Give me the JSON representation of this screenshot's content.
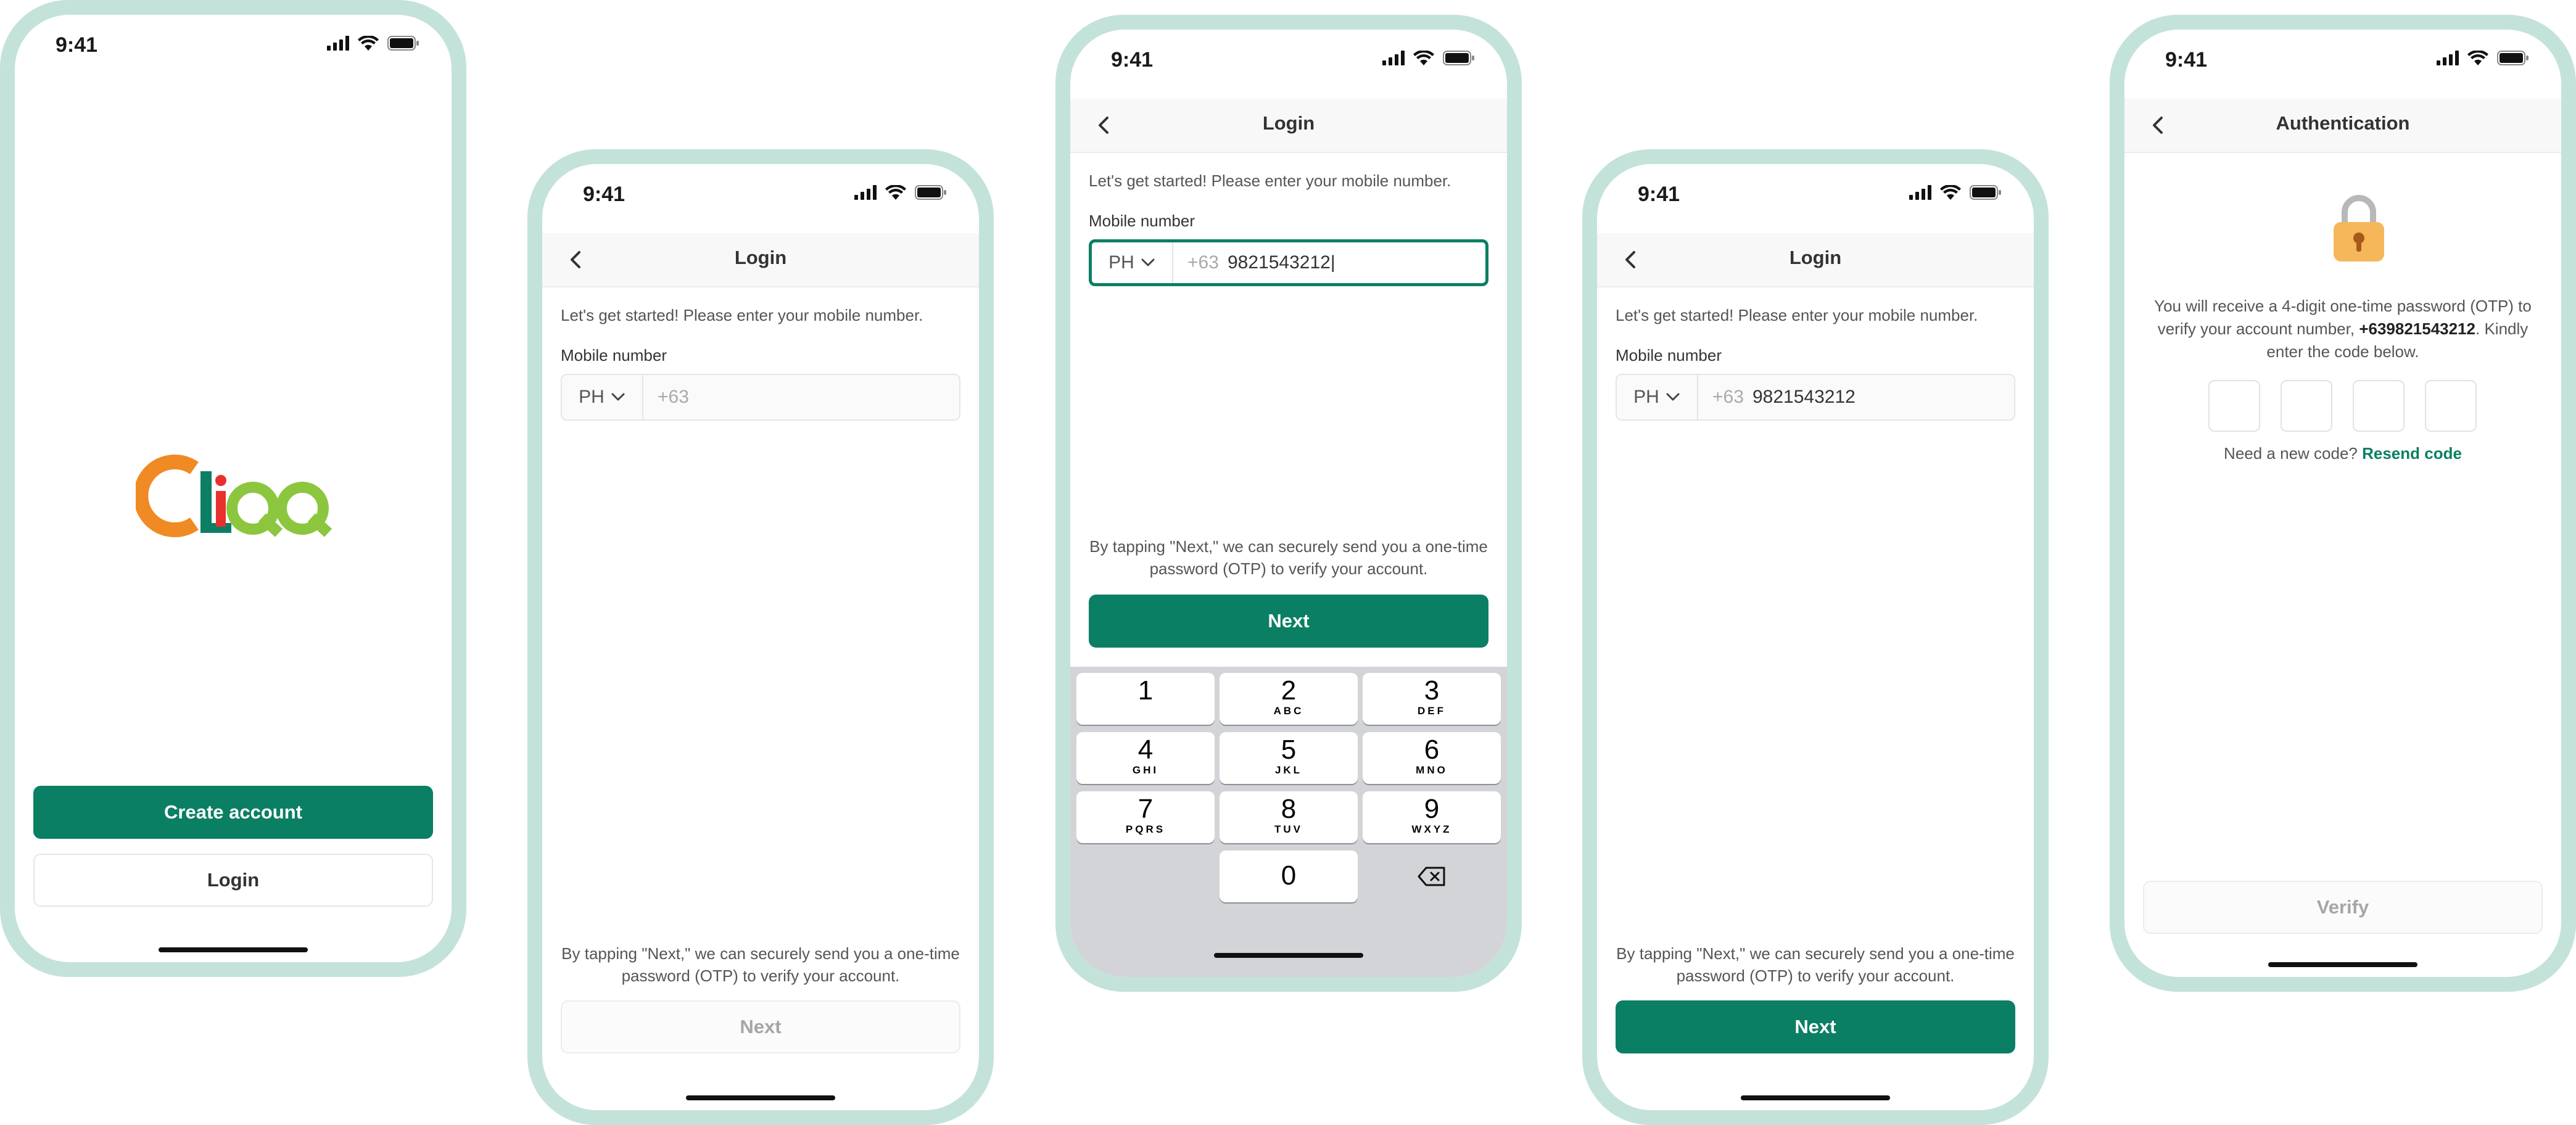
{
  "status": {
    "time": "9:41"
  },
  "brand": {
    "logo_text": "CliQQ",
    "green": "#0b7f63",
    "phone_frame": "#c3e3da"
  },
  "welcome": {
    "create_account": "Create account",
    "login": "Login"
  },
  "login_common": {
    "title": "Login",
    "intro": "Let's get started! Please enter your mobile number.",
    "mobile_label": "Mobile number",
    "country_code": "PH",
    "dial_prefix": "+63",
    "terms": "By tapping \"Next,\" we can securely send you a one-time password (OTP) to verify your account.",
    "next": "Next"
  },
  "login_typing": {
    "number": "9821543212|"
  },
  "login_filled": {
    "number": "9821543212"
  },
  "keyboard": {
    "keys": [
      {
        "digit": "1",
        "letters": ""
      },
      {
        "digit": "2",
        "letters": "ABC"
      },
      {
        "digit": "3",
        "letters": "DEF"
      },
      {
        "digit": "4",
        "letters": "GHI"
      },
      {
        "digit": "5",
        "letters": "JKL"
      },
      {
        "digit": "6",
        "letters": "MNO"
      },
      {
        "digit": "7",
        "letters": "PQRS"
      },
      {
        "digit": "8",
        "letters": "TUV"
      },
      {
        "digit": "9",
        "letters": "WXYZ"
      },
      {
        "digit": "0",
        "letters": ""
      }
    ]
  },
  "auth": {
    "title": "Authentication",
    "message_before": "You will receive a 4-digit one-time password (OTP) to verify your account number, ",
    "phone": "+639821543212",
    "message_after": ". Kindly enter the code below.",
    "need_code": "Need a new code?",
    "resend": "Resend code",
    "verify": "Verify"
  }
}
